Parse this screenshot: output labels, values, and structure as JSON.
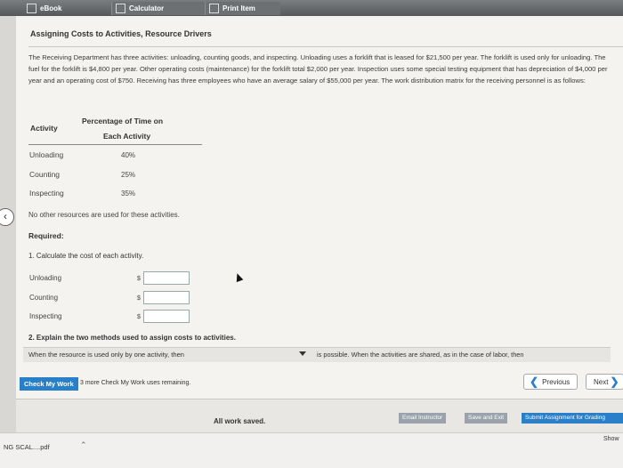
{
  "tabs": [
    {
      "label": "eBook",
      "icon": "book-icon"
    },
    {
      "label": "Calculator",
      "icon": "calculator-icon"
    },
    {
      "label": "Print Item",
      "icon": "print-icon"
    }
  ],
  "title": "Assigning Costs to Activities, Resource Drivers",
  "paragraph": "The Receiving Department has three activities: unloading, counting goods, and inspecting. Unloading uses a forklift that is leased for $21,500 per year. The forklift is used only for unloading. The fuel for the forklift is $4,800 per year. Other operating costs (maintenance) for the forklift total $2,000 per year. Inspection uses some special testing equipment that has depreciation of $4,000 per year and an operating cost of $750. Receiving has three employees who have an average salary of $55,000 per year. The work distribution matrix for the receiving personnel is as follows:",
  "table": {
    "header_activity": "Activity",
    "header_pct_line1": "Percentage of Time on",
    "header_pct_line2": "Each Activity",
    "rows": [
      {
        "activity": "Unloading",
        "pct": "40%"
      },
      {
        "activity": "Counting",
        "pct": "25%"
      },
      {
        "activity": "Inspecting",
        "pct": "35%"
      }
    ]
  },
  "note": "No other resources are used for these activities.",
  "required_label": "Required:",
  "q1": "1. Calculate the cost of each activity.",
  "answers": [
    {
      "label": "Unloading",
      "currency": "$",
      "value": ""
    },
    {
      "label": "Counting",
      "currency": "$",
      "value": ""
    },
    {
      "label": "Inspecting",
      "currency": "$",
      "value": ""
    }
  ],
  "q2": "2. Explain the two methods used to assign costs to activities.",
  "q2_sentence_start": "When the resource is used only by one activity, then",
  "q2_sentence_end": "is possible. When the activities are shared, as in the case of labor, then",
  "check_button": "Check My Work",
  "check_note": "3 more Check My Work uses remaining.",
  "previous": "Previous",
  "next": "Next",
  "saved_status": "All work saved.",
  "email_button": "Email Instructor",
  "save_exit_button": "Save and Exit",
  "submit_button": "Submit Assignment for Grading",
  "download_file": "NG SCAL....pdf",
  "show_all": "Show"
}
